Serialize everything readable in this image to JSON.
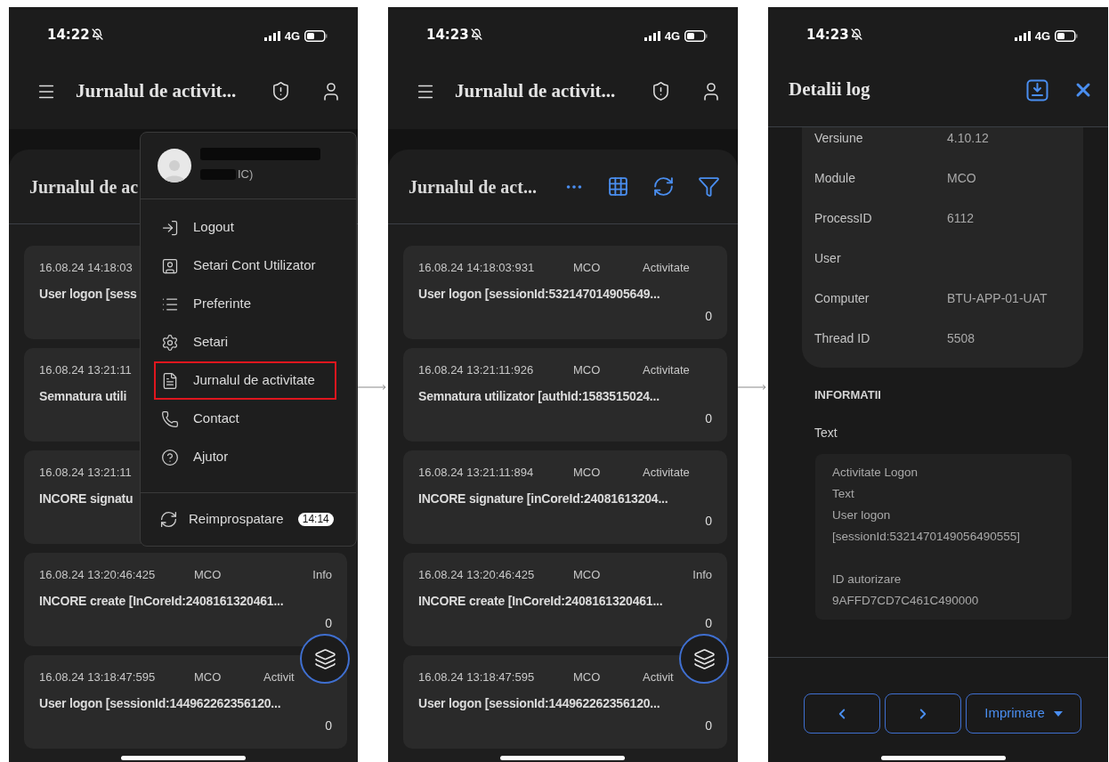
{
  "screens": [
    {
      "kind": "list",
      "status_bar": {
        "time": "14:22",
        "network": "4G"
      },
      "header": {
        "title": "Jurnalul de activit..."
      },
      "panel": {
        "title": "Jurnalul de ac"
      },
      "logs": [
        {
          "timestamp": "16.08.24 14:18:03",
          "message": "User logon [sess"
        },
        {
          "timestamp": "16.08.24 13:21:11",
          "message": "Semnatura utili"
        },
        {
          "timestamp": "16.08.24 13:21:11",
          "message": "INCORE signatu"
        },
        {
          "timestamp": "16.08.24 13:20:46:425",
          "module": "MCO",
          "type": "Info",
          "message": "INCORE create [InCoreId:2408161320461...",
          "count": "0"
        },
        {
          "timestamp": "16.08.24 13:18:47:595",
          "module": "MCO",
          "type": "Activit",
          "message": "User logon [sessionId:144962262356120...",
          "count": "0"
        }
      ],
      "menu": {
        "account_suffix": "IC)",
        "items": [
          {
            "kind": "logout",
            "label": "Logout",
            "highlighted": false
          },
          {
            "kind": "account",
            "label": "Setari Cont Utilizator",
            "highlighted": false
          },
          {
            "kind": "preferences",
            "label": "Preferinte",
            "highlighted": false
          },
          {
            "kind": "settings",
            "label": "Setari",
            "highlighted": false
          },
          {
            "kind": "log",
            "label": "Jurnalul de activitate",
            "highlighted": true
          },
          {
            "kind": "contact",
            "label": "Contact",
            "highlighted": false
          },
          {
            "kind": "help",
            "label": "Ajutor",
            "highlighted": false
          }
        ],
        "refresh": {
          "label": "Reimprospatare",
          "badge": "14:14"
        }
      }
    },
    {
      "kind": "list",
      "status_bar": {
        "time": "14:23",
        "network": "4G"
      },
      "header": {
        "title": "Jurnalul de activit..."
      },
      "panel": {
        "title": "Jurnalul de act...",
        "toolbar": true
      },
      "logs": [
        {
          "timestamp": "16.08.24 14:18:03:931",
          "module": "MCO",
          "type": "Activitate",
          "message": "User logon [sessionId:532147014905649...",
          "count": "0"
        },
        {
          "timestamp": "16.08.24 13:21:11:926",
          "module": "MCO",
          "type": "Activitate",
          "message": "Semnatura utilizator [authId:1583515024...",
          "count": "0"
        },
        {
          "timestamp": "16.08.24 13:21:11:894",
          "module": "MCO",
          "type": "Activitate",
          "message": "INCORE signature [inCoreId:24081613204...",
          "count": "0"
        },
        {
          "timestamp": "16.08.24 13:20:46:425",
          "module": "MCO",
          "type": "Info",
          "message": "INCORE create [InCoreId:2408161320461...",
          "count": "0"
        },
        {
          "timestamp": "16.08.24 13:18:47:595",
          "module": "MCO",
          "type": "Activit",
          "message": "User logon [sessionId:144962262356120...",
          "count": "0"
        }
      ]
    },
    {
      "kind": "detail",
      "status_bar": {
        "time": "14:23",
        "network": "4G"
      },
      "header": {
        "title": "Detalii log"
      },
      "properties": [
        {
          "label": "Versiune",
          "value": "4.10.12"
        },
        {
          "label": "Module",
          "value": "MCO"
        },
        {
          "label": "ProcessID",
          "value": "6112"
        },
        {
          "label": "User"
        },
        {
          "label": "Computer",
          "value": "BTU-APP-01-UAT"
        },
        {
          "label": "Thread ID",
          "value": "5508"
        }
      ],
      "section_title": "INFORMATII",
      "text_label": "Text",
      "text_paragraphs": [
        [
          "Activitate Logon",
          "Text",
          "User logon",
          "[sessionId:5321470149056490555]"
        ],
        [
          "ID autorizare",
          "9AFFD7CD7C461C490000"
        ]
      ],
      "footer_buttons": [
        {
          "kind": "prev"
        },
        {
          "kind": "next"
        },
        {
          "kind": "dropdown",
          "label": "Imprimare"
        }
      ]
    }
  ]
}
